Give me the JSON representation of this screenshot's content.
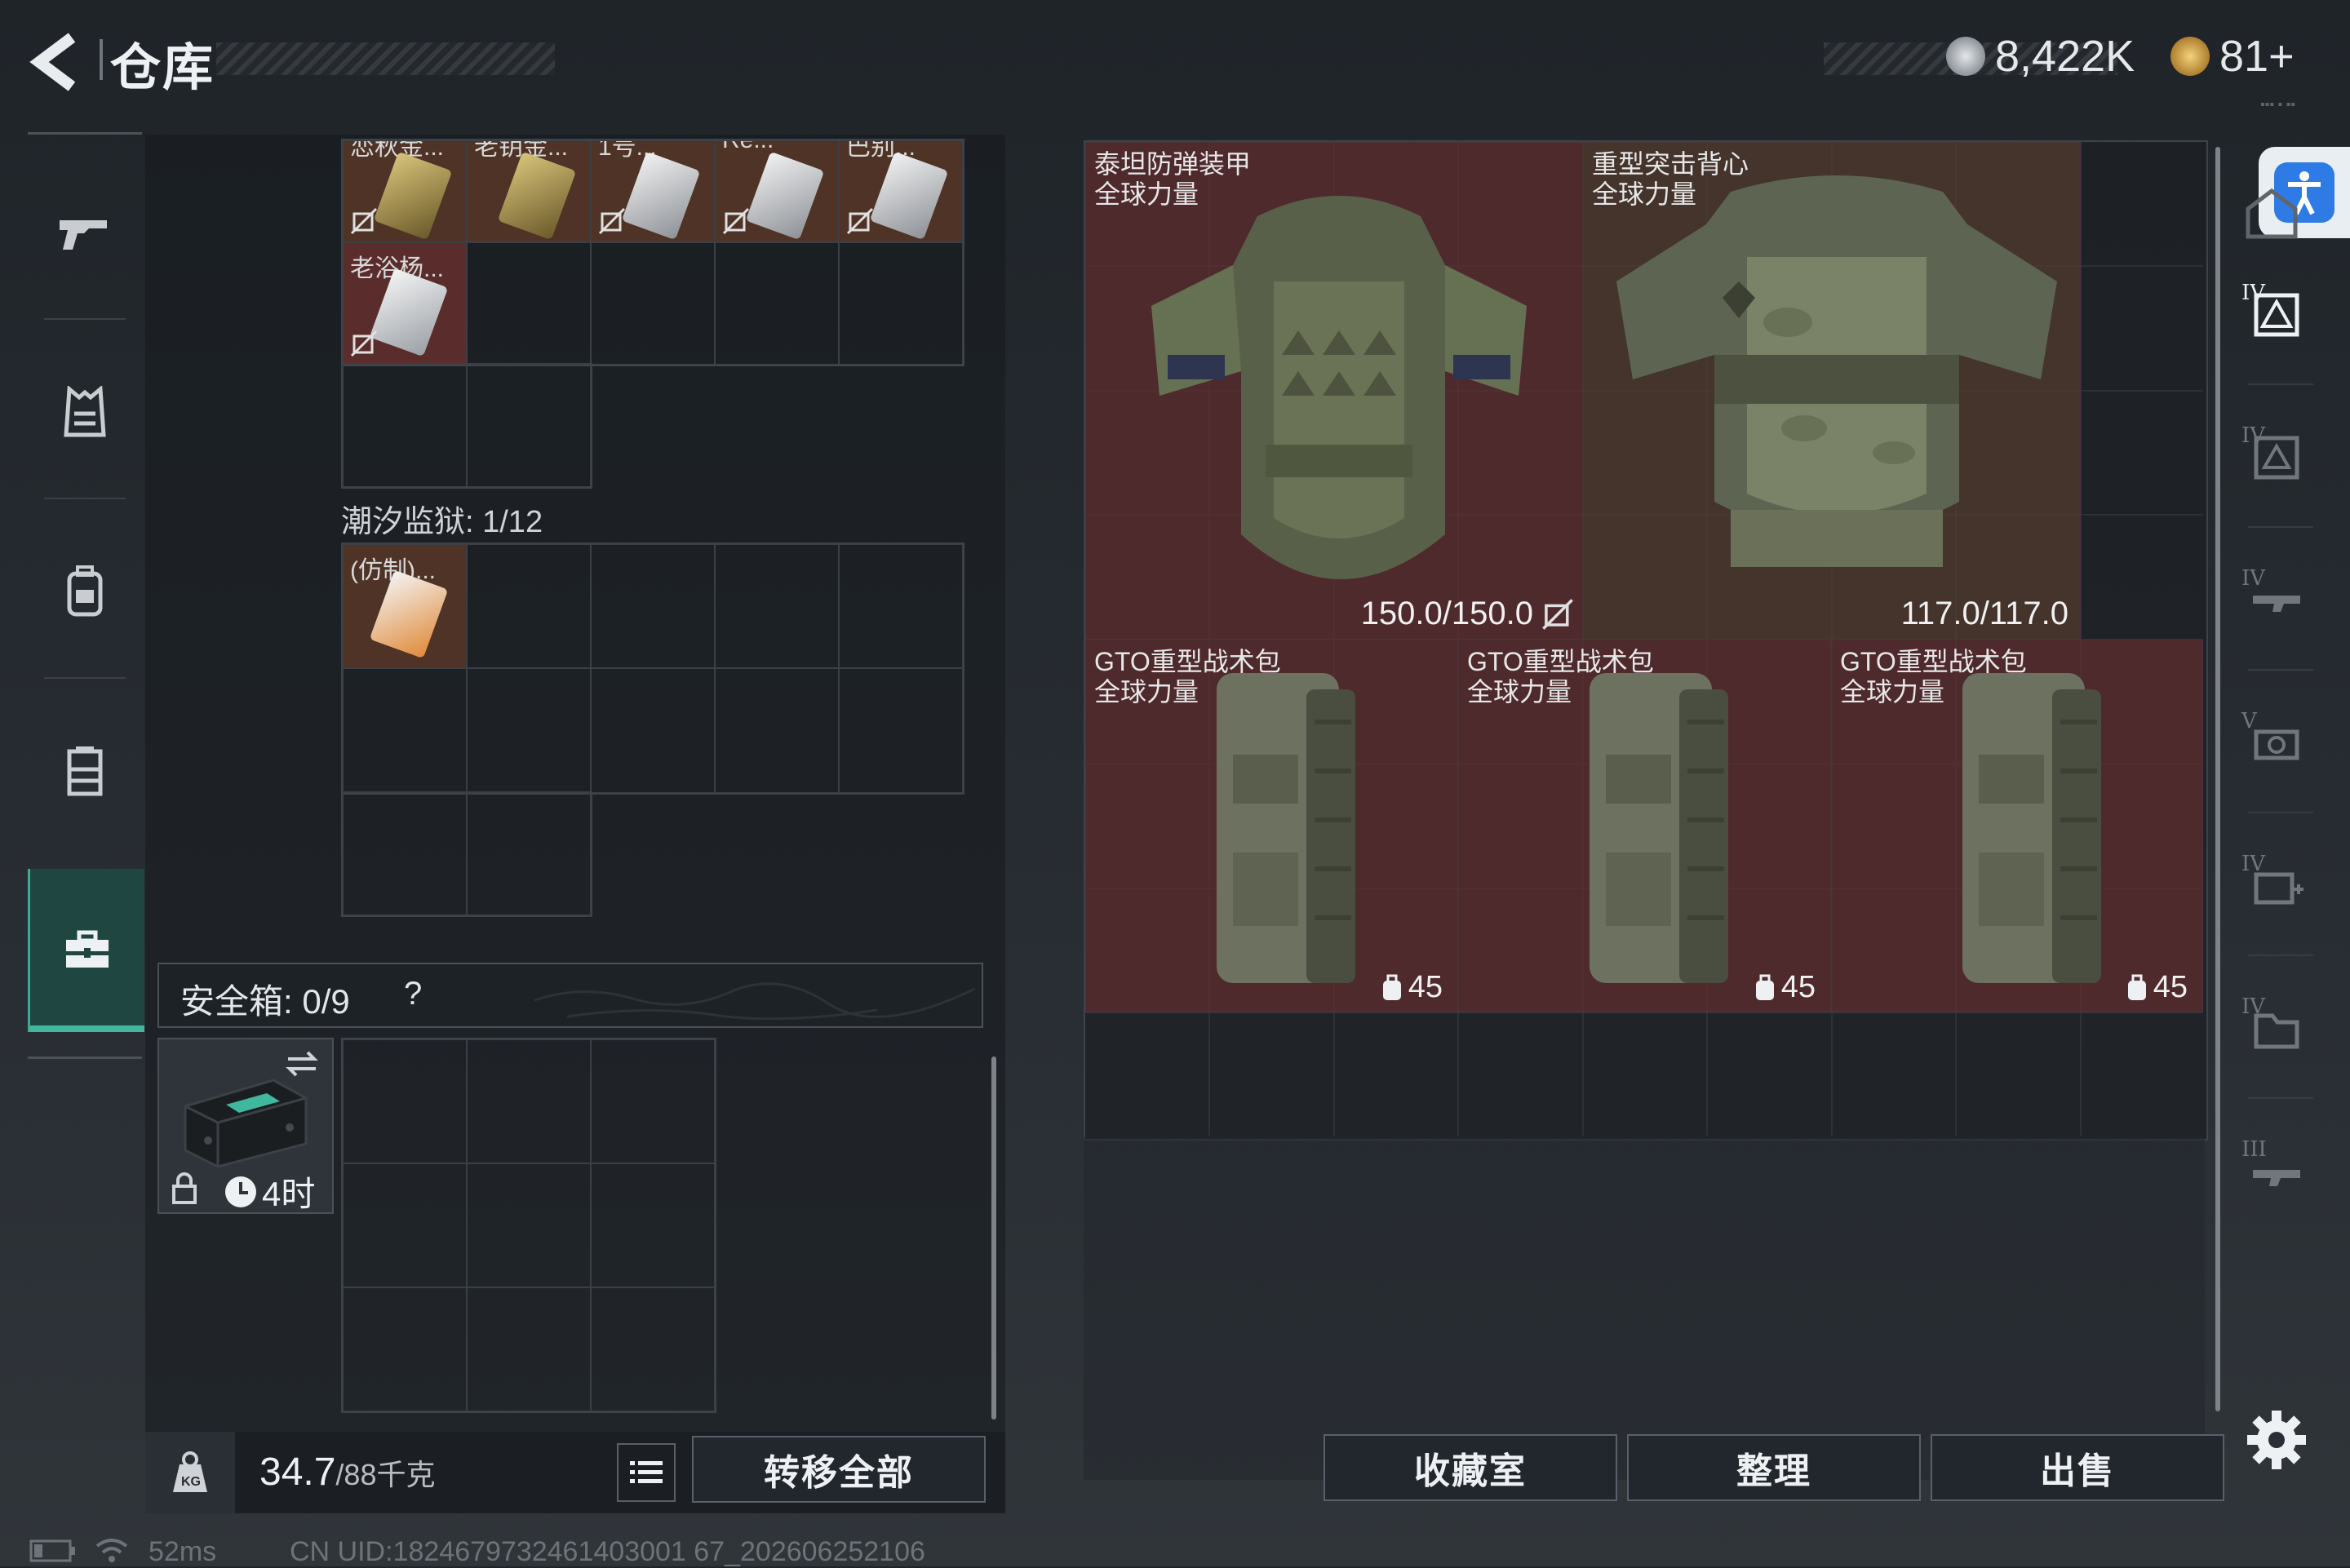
{
  "header": {
    "title": "仓库",
    "currency_1": "8,422K",
    "currency_2": "81+",
    "colors": {
      "coin_silver": "#b7bcc2",
      "coin_gold": "#d9a441"
    }
  },
  "left_nav": {
    "items": [
      {
        "icon": "gun-icon"
      },
      {
        "icon": "armor-vest-icon"
      },
      {
        "icon": "backpack-icon"
      },
      {
        "icon": "rig-icon"
      },
      {
        "icon": "case-icon",
        "active": true
      }
    ],
    "accent": "#3fb89e"
  },
  "storage": {
    "top_items": [
      "恋秋金...",
      "老钥金...",
      "1号...",
      "Re...",
      "巴别..."
    ],
    "second_row_item": "老浴杨...",
    "section_title": "潮汐监狱: 1/12",
    "section_item": "(仿制)...",
    "safebox_label": "安全箱: 0/9",
    "safebox_help": "?",
    "safecase_time": "4时"
  },
  "bottom_left": {
    "weight_value": "34.7",
    "weight_max": "/88千克",
    "transfer_all_label": "转移全部"
  },
  "gear": [
    {
      "name": "泰坦防弹装甲",
      "sub": "全球力量",
      "durability": "150.0/150.0",
      "no_sell": true
    },
    {
      "name": "重型突击背心",
      "sub": "全球力量",
      "durability": "117.0/117.0",
      "no_sell": false
    },
    {
      "name": "GTO重型战术包",
      "sub": "全球力量",
      "weight": "45"
    },
    {
      "name": "GTO重型战术包",
      "sub": "全球力量",
      "weight": "45"
    },
    {
      "name": "GTO重型战术包",
      "sub": "全球力量",
      "weight": "45"
    }
  ],
  "bottom_right": {
    "collection_label": "收藏室",
    "sort_label": "整理",
    "sell_label": "出售"
  },
  "filters": [
    {
      "tier": "IV",
      "icon": "armor-filter-icon"
    },
    {
      "tier": "IV",
      "icon": "helmet-filter-icon"
    },
    {
      "tier": "IV",
      "icon": "rifle-filter-icon"
    },
    {
      "tier": "V",
      "icon": "scope-filter-icon"
    },
    {
      "tier": "IV",
      "icon": "medkit-filter-icon"
    },
    {
      "tier": "IV",
      "icon": "folder-filter-icon"
    },
    {
      "tier": "III",
      "icon": "weapon-filter-icon"
    }
  ],
  "status": {
    "ping": "52ms",
    "uid": "CN UID:1824679732461403001 67_202606252106"
  }
}
